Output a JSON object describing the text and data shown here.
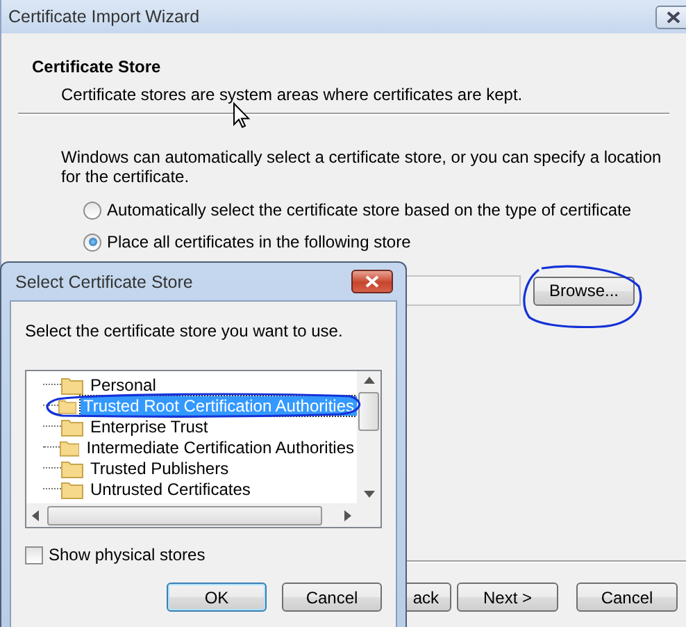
{
  "wizard": {
    "title": "Certificate Import Wizard",
    "header": {
      "title": "Certificate Store",
      "subtitle": "Certificate stores are system areas where certificates are kept."
    },
    "intro": "Windows can automatically select a certificate store, or you can specify a location for the certificate.",
    "options": [
      {
        "label": "Automatically select the certificate store based on the type of certificate",
        "selected": false
      },
      {
        "label": "Place all certificates in the following store",
        "selected": true
      }
    ],
    "browse_button": "Browse...",
    "buttons": [
      {
        "label": "ack"
      },
      {
        "label": "Next >"
      },
      {
        "label": "Cancel"
      }
    ]
  },
  "dialog": {
    "title": "Select Certificate Store",
    "prompt": "Select the certificate store you want to use.",
    "stores": [
      {
        "label": "Personal",
        "selected": false
      },
      {
        "label": "Trusted Root Certification Authorities",
        "selected": true
      },
      {
        "label": "Enterprise Trust",
        "selected": false
      },
      {
        "label": "Intermediate Certification Authorities",
        "selected": false
      },
      {
        "label": "Trusted Publishers",
        "selected": false
      },
      {
        "label": "Untrusted Certificates",
        "selected": false
      }
    ],
    "show_physical": {
      "label": "Show physical stores",
      "checked": false
    },
    "buttons": [
      "OK",
      "Cancel"
    ]
  }
}
